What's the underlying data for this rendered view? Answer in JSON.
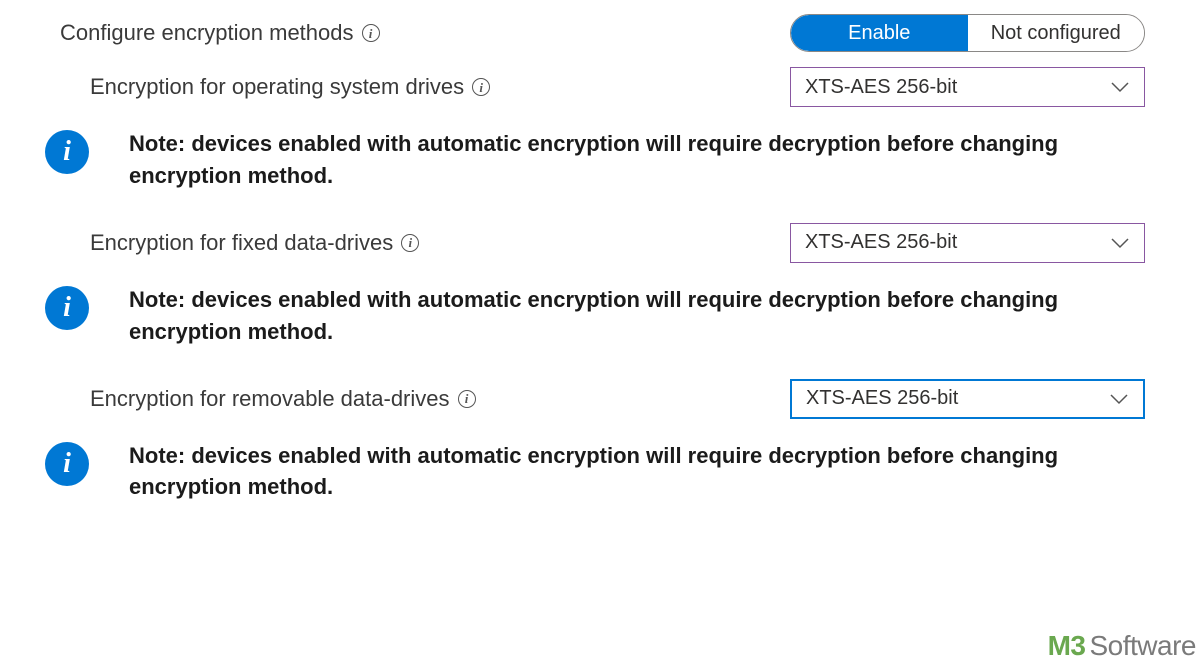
{
  "configure": {
    "label": "Configure encryption methods",
    "toggle": {
      "enable": "Enable",
      "not_configured": "Not configured"
    }
  },
  "rows": {
    "os_drives": {
      "label": "Encryption for operating system drives",
      "value": "XTS-AES 256-bit"
    },
    "fixed_drives": {
      "label": "Encryption for fixed data-drives",
      "value": "XTS-AES 256-bit"
    },
    "removable_drives": {
      "label": "Encryption for removable data-drives",
      "value": "XTS-AES 256-bit"
    }
  },
  "note_text": "Note: devices enabled with automatic encryption will require decryption before changing encryption method.",
  "watermark": {
    "brand": "M3",
    "word": "Software"
  }
}
